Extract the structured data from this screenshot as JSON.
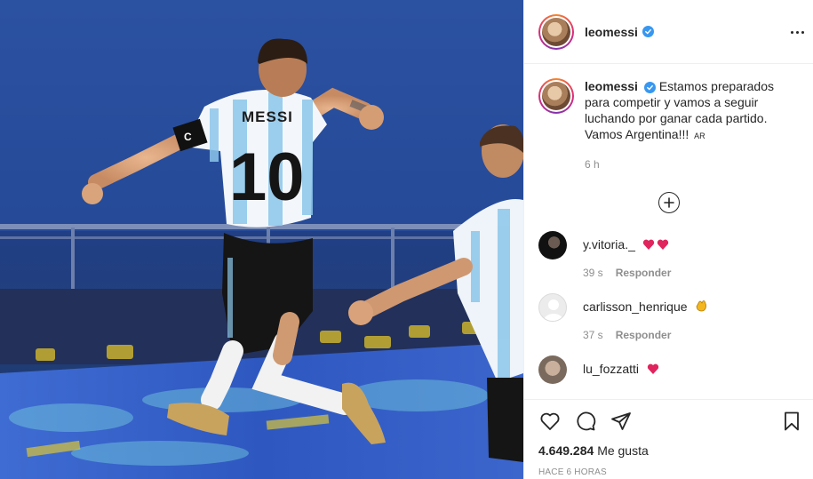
{
  "post": {
    "photo_description_icon": "post-photo",
    "jersey_name": "MESSI",
    "jersey_number": "10",
    "armband_letter": "C"
  },
  "header": {
    "username": "leomessi",
    "verified_icon": "verified-badge-icon",
    "more_icon": "more-options-icon"
  },
  "caption": {
    "username": "leomessi",
    "text": "Estamos preparados para competir y vamos a seguir luchando por ganar cada partido. Vamos Argentina!!! ",
    "flag": "AR",
    "time": "6 h"
  },
  "load_more_icon": "plus-circle-icon",
  "comments": [
    {
      "username": "y.vitoria._",
      "emoji": "❤️❤️",
      "time": "39 s",
      "reply_label": "Responder",
      "avatar_color": "#111111"
    },
    {
      "username": "carlisson_henrique",
      "emoji": "👏",
      "time": "37 s",
      "reply_label": "Responder",
      "avatar_color": "#e6e6e6"
    },
    {
      "username": "lu_fozzatti",
      "emoji": "❤️",
      "time": "",
      "reply_label": "",
      "avatar_color": "#9a8778"
    }
  ],
  "actions": {
    "like_icon": "heart-icon",
    "comment_icon": "comment-icon",
    "share_icon": "share-icon",
    "save_icon": "bookmark-icon"
  },
  "likes": {
    "count": "4.649.284",
    "label": "Me gusta"
  },
  "timeago": "HACE 6 HORAS",
  "colors": {
    "verified": "#3897f0",
    "heart": "#ed4956",
    "muted": "#8e8e8e",
    "text": "#262626"
  }
}
